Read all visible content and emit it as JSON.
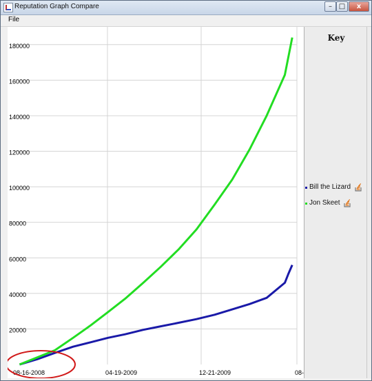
{
  "window": {
    "title": "Reputation Graph Compare",
    "controls": {
      "minimize": "–",
      "maximize": "□",
      "close": "x"
    }
  },
  "menu": {
    "file_label": "File"
  },
  "key": {
    "title": "Key"
  },
  "colors": {
    "grid": "#d4d4d4",
    "axis_text": "#000000",
    "annotation": "#d11a1a"
  },
  "chart_data": {
    "type": "line",
    "ylim": [
      0,
      190000
    ],
    "yticks": [
      20000,
      40000,
      60000,
      80000,
      100000,
      120000,
      140000,
      160000,
      180000
    ],
    "xlim": [
      "2008-08-01",
      "2010-08-01"
    ],
    "xticks": [
      "08-16-2008",
      "04-19-2009",
      "12-21-2009",
      "08-"
    ],
    "series": [
      {
        "name": "Bill the Lizard",
        "color": "#1a1aa8",
        "x": [
          "2008-08-16",
          "2008-10-01",
          "2008-11-15",
          "2009-01-01",
          "2009-02-15",
          "2009-04-01",
          "2009-05-15",
          "2009-07-01",
          "2009-08-15",
          "2009-10-01",
          "2009-11-15",
          "2010-01-01",
          "2010-02-15",
          "2010-04-01",
          "2010-05-15",
          "2010-07-01",
          "2010-07-10",
          "2010-07-20"
        ],
        "values": [
          0,
          3000,
          6500,
          10000,
          12500,
          15000,
          17000,
          19500,
          21500,
          23500,
          25500,
          28000,
          31000,
          34000,
          37500,
          46000,
          51000,
          56000
        ]
      },
      {
        "name": "Jon Skeet",
        "color": "#22dd22",
        "x": [
          "2008-08-16",
          "2008-10-01",
          "2008-11-15",
          "2009-01-01",
          "2009-02-15",
          "2009-04-01",
          "2009-05-15",
          "2009-07-01",
          "2009-08-15",
          "2009-10-01",
          "2009-11-15",
          "2010-01-01",
          "2010-02-15",
          "2010-04-01",
          "2010-05-15",
          "2010-07-01",
          "2010-07-20"
        ],
        "values": [
          0,
          4000,
          8000,
          15000,
          22000,
          29500,
          37000,
          46000,
          55000,
          65000,
          76000,
          90000,
          104000,
          121000,
          140000,
          163000,
          184000
        ]
      }
    ]
  }
}
